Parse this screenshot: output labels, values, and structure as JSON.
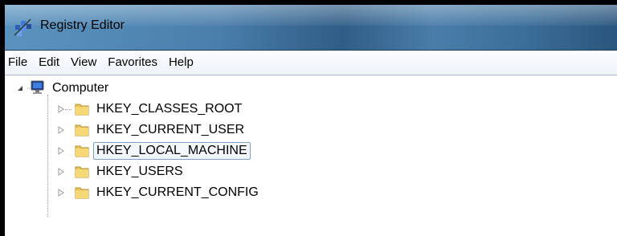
{
  "window": {
    "title": "Registry Editor"
  },
  "menu": [
    "File",
    "Edit",
    "View",
    "Favorites",
    "Help"
  ],
  "tree": {
    "root": {
      "label": "Computer",
      "expanded": true
    },
    "keys": [
      {
        "label": "HKEY_CLASSES_ROOT",
        "selected": false
      },
      {
        "label": "HKEY_CURRENT_USER",
        "selected": false
      },
      {
        "label": "HKEY_LOCAL_MACHINE",
        "selected": true
      },
      {
        "label": "HKEY_USERS",
        "selected": false
      },
      {
        "label": "HKEY_CURRENT_CONFIG",
        "selected": false
      }
    ]
  },
  "icons": {
    "app": "registry-editor-icon",
    "root": "computer-icon",
    "key": "folder-icon"
  },
  "colors": {
    "titlebar": "#4a7eab",
    "selection_border": "#7da2ce",
    "folder": "#e8c45c"
  }
}
